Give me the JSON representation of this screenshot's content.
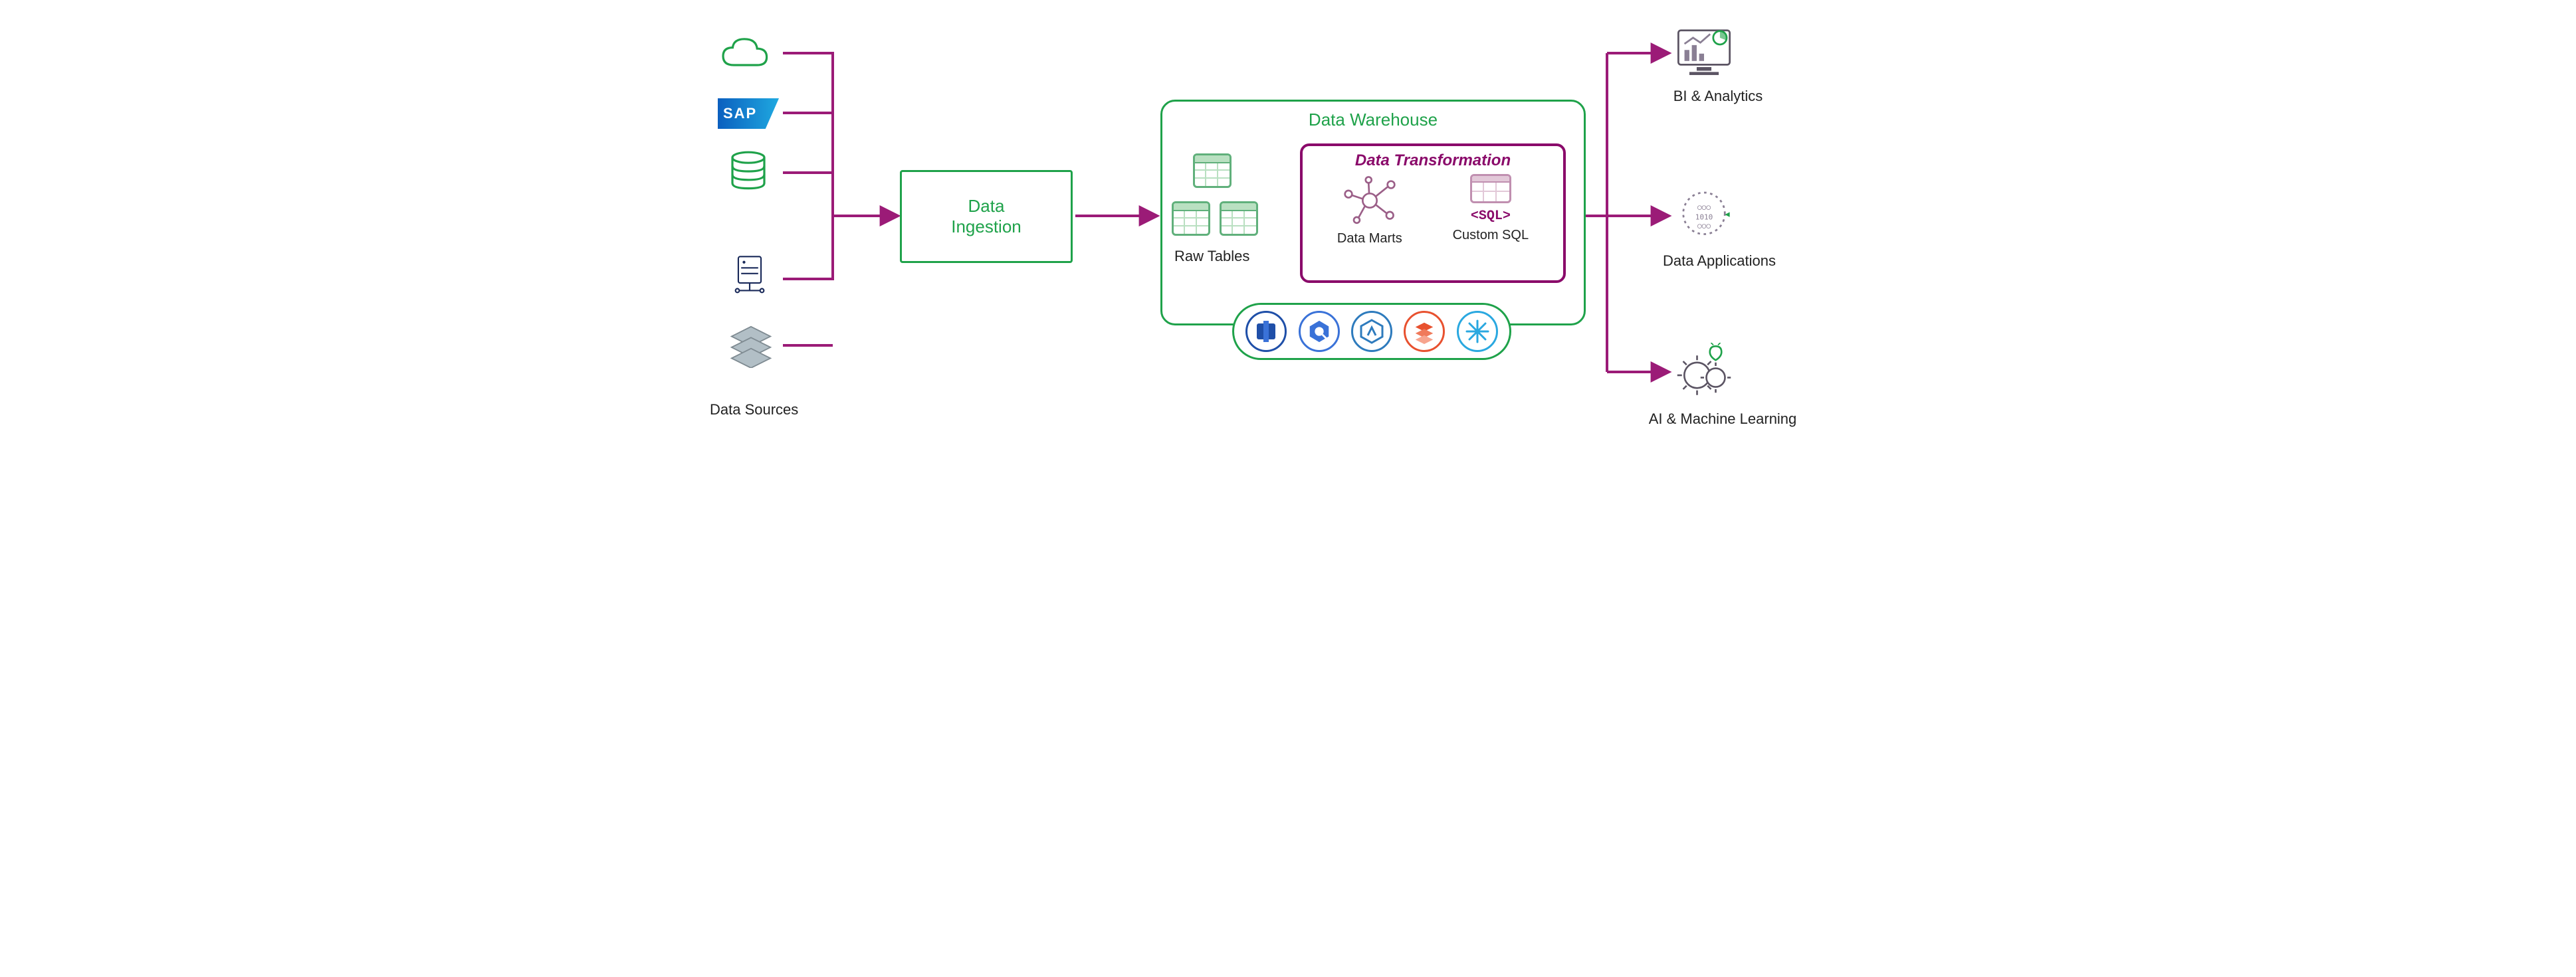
{
  "sources": {
    "label": "Data Sources",
    "items": [
      {
        "name": "cloud"
      },
      {
        "name": "sap",
        "text": "SAP"
      },
      {
        "name": "database"
      },
      {
        "name": "server"
      },
      {
        "name": "stack"
      }
    ]
  },
  "ingestion": {
    "title": "Data\nIngestion"
  },
  "warehouse": {
    "title": "Data Warehouse",
    "raw_tables_label": "Raw Tables",
    "transformation": {
      "title": "Data Transformation",
      "data_marts_label": "Data Marts",
      "custom_sql_label": "Custom SQL",
      "sql_tag": "<SQL>"
    },
    "tech_logos": [
      {
        "name": "redshift"
      },
      {
        "name": "bigquery"
      },
      {
        "name": "synapse"
      },
      {
        "name": "databricks"
      },
      {
        "name": "snowflake"
      }
    ]
  },
  "outputs": [
    {
      "name": "bi-analytics",
      "label": "BI & Analytics"
    },
    {
      "name": "data-applications",
      "label": "Data Applications"
    },
    {
      "name": "ai-ml",
      "label": "AI & Machine Learning"
    }
  ],
  "colors": {
    "green": "#1fa24a",
    "magenta": "#9b1b77",
    "navy": "#1a2a5a"
  }
}
